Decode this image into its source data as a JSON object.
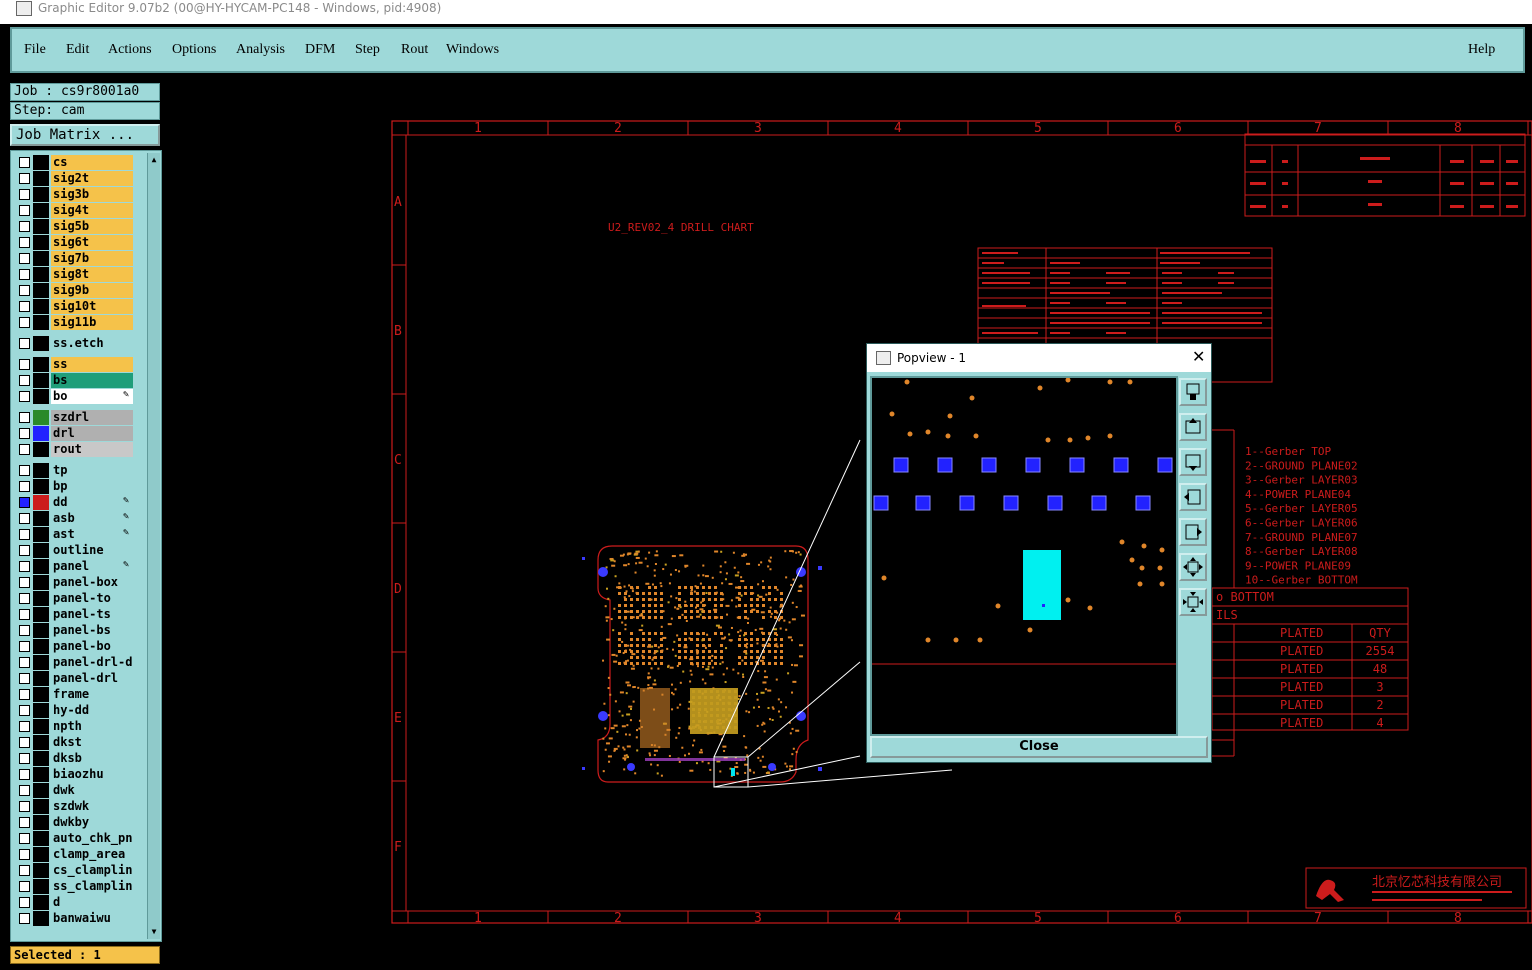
{
  "window": {
    "title": "Graphic Editor 9.07b2 (00@HY-HYCAM-PC148 - Windows, pid:4908)"
  },
  "menu": {
    "items": [
      "File",
      "Edit",
      "Actions",
      "Options",
      "Analysis",
      "DFM",
      "Step",
      "Rout",
      "Windows"
    ],
    "help": "Help"
  },
  "job": {
    "job": "Job : cs9r8001a0",
    "step": "Step: cam",
    "matrix_button": "Job Matrix ..."
  },
  "layers": [
    {
      "name": "cs",
      "color": "#f5c24a"
    },
    {
      "name": "sig2t",
      "color": "#f5c24a"
    },
    {
      "name": "sig3b",
      "color": "#f5c24a"
    },
    {
      "name": "sig4t",
      "color": "#f5c24a"
    },
    {
      "name": "sig5b",
      "color": "#f5c24a"
    },
    {
      "name": "sig6t",
      "color": "#f5c24a"
    },
    {
      "name": "sig7b",
      "color": "#f5c24a"
    },
    {
      "name": "sig8t",
      "color": "#f5c24a"
    },
    {
      "name": "sig9b",
      "color": "#f5c24a"
    },
    {
      "name": "sig10t",
      "color": "#f5c24a"
    },
    {
      "name": "sig11b",
      "color": "#f5c24a"
    },
    {
      "name": "ss.etch",
      "color": "#9ed9d9"
    },
    {
      "name": "ss",
      "color": "#f5c24a"
    },
    {
      "name": "bs",
      "color": "#1f9e7a"
    },
    {
      "name": "bo",
      "color": "#ffffff"
    },
    {
      "name": "szdrl",
      "color": "#b0b0b0"
    },
    {
      "name": "drl",
      "color": "#b0b0b0"
    },
    {
      "name": "rout",
      "color": "#c8c8c8"
    },
    {
      "name": "tp",
      "color": "#9ed9d9"
    },
    {
      "name": "bp",
      "color": "#9ed9d9"
    },
    {
      "name": "dd",
      "color": "#9ed9d9"
    },
    {
      "name": "asb",
      "color": "#9ed9d9"
    },
    {
      "name": "ast",
      "color": "#9ed9d9"
    },
    {
      "name": "outline",
      "color": "#9ed9d9"
    },
    {
      "name": "panel",
      "color": "#9ed9d9"
    },
    {
      "name": "panel-box",
      "color": "#9ed9d9"
    },
    {
      "name": "panel-to",
      "color": "#9ed9d9"
    },
    {
      "name": "panel-ts",
      "color": "#9ed9d9"
    },
    {
      "name": "panel-bs",
      "color": "#9ed9d9"
    },
    {
      "name": "panel-bo",
      "color": "#9ed9d9"
    },
    {
      "name": "panel-drl-d",
      "color": "#9ed9d9"
    },
    {
      "name": "panel-drl",
      "color": "#9ed9d9"
    },
    {
      "name": "frame",
      "color": "#9ed9d9"
    },
    {
      "name": "hy-dd",
      "color": "#9ed9d9"
    },
    {
      "name": "npth",
      "color": "#9ed9d9"
    },
    {
      "name": "dkst",
      "color": "#9ed9d9"
    },
    {
      "name": "dksb",
      "color": "#9ed9d9"
    },
    {
      "name": "biaozhu",
      "color": "#9ed9d9"
    },
    {
      "name": "dwk",
      "color": "#9ed9d9"
    },
    {
      "name": "szdwk",
      "color": "#9ed9d9"
    },
    {
      "name": "dwkby",
      "color": "#9ed9d9"
    },
    {
      "name": "auto_chk_pn",
      "color": "#9ed9d9"
    },
    {
      "name": "clamp_area",
      "color": "#9ed9d9"
    },
    {
      "name": "cs_clampline",
      "color": "#9ed9d9"
    },
    {
      "name": "ss_clampline",
      "color": "#9ed9d9"
    },
    {
      "name": "d",
      "color": "#9ed9d9"
    },
    {
      "name": "banwaiwu",
      "color": "#9ed9d9"
    }
  ],
  "selected": "Selected : 1",
  "drawing": {
    "chart_title": "U2_REV02_4 DRILL CHART",
    "col_numbers": [
      "1",
      "2",
      "3",
      "4",
      "5",
      "6",
      "7",
      "8"
    ],
    "row_letters": [
      "A",
      "B",
      "C",
      "D",
      "E",
      "F"
    ],
    "layer_list": [
      "1--Gerber TOP",
      "2--GROUND PLANE02",
      "3--Gerber LAYER03",
      "4--POWER PLANE04",
      "5--Gerber LAYER05",
      "6--Gerber LAYER06",
      "7--GROUND PLANE07",
      "8--Gerber LAYER08",
      "9--POWER PLANE09",
      "10--Gerber BOTTOM"
    ],
    "drill_table_head1": "o BOTTOM",
    "drill_table_head2": "ILS",
    "drill_table": [
      {
        "col2": "PLATED",
        "col3": "QTY"
      },
      {
        "col2": "PLATED",
        "col3": "2554"
      },
      {
        "col2": "PLATED",
        "col3": "48"
      },
      {
        "col2": "PLATED",
        "col3": "3"
      },
      {
        "col2": "PLATED",
        "col3": "2"
      },
      {
        "col2": "PLATED",
        "col3": "4"
      }
    ],
    "company": "北京忆芯科技有限公司"
  },
  "popup": {
    "title": "Popview - 1",
    "close": "Close"
  },
  "colors": {
    "cyan": "#9ed9d9",
    "red": "#cc1c1c",
    "orange": "#e0862a",
    "blue": "#2222ff"
  }
}
